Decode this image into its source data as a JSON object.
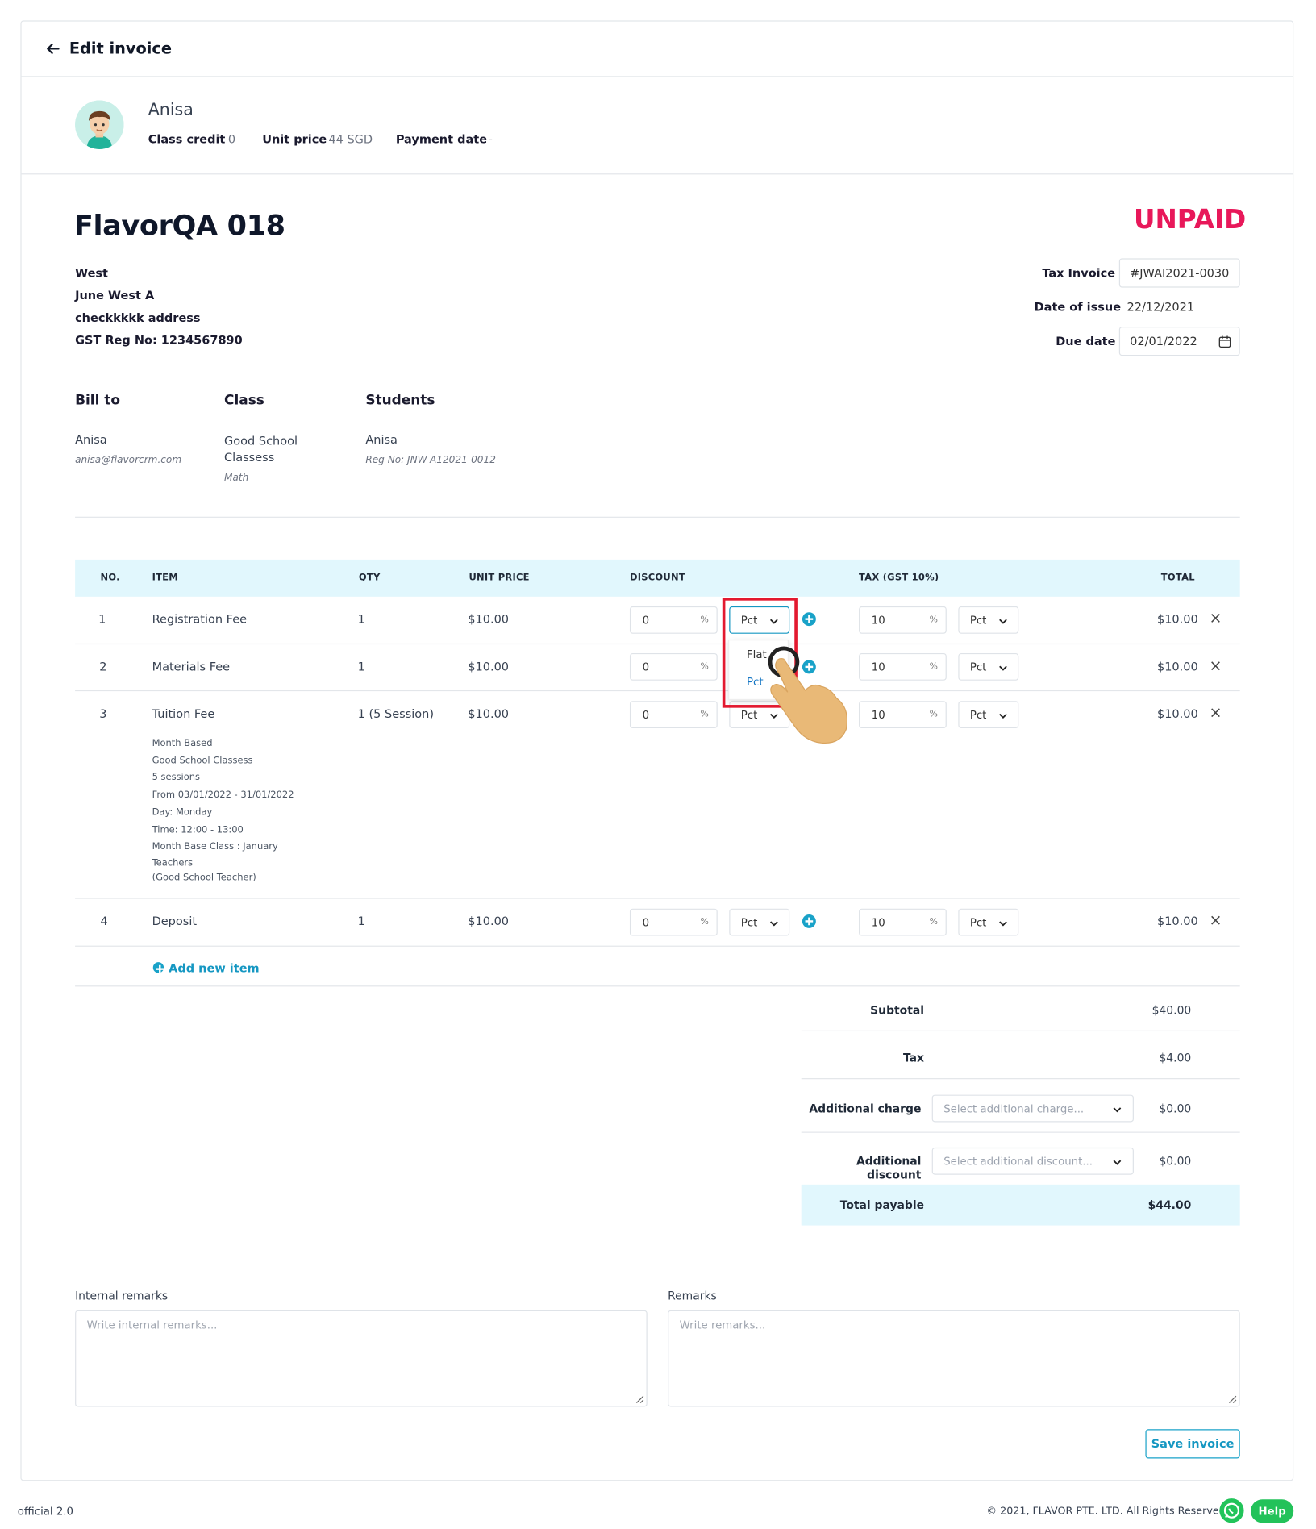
{
  "header": {
    "title": "Edit invoice"
  },
  "student": {
    "name": "Anisa",
    "class_credit_label": "Class credit",
    "class_credit_value": "0",
    "unit_price_label": "Unit price",
    "unit_price_value": "44 SGD",
    "payment_date_label": "Payment date",
    "payment_date_value": "-"
  },
  "invoice": {
    "title": "FlavorQA 018",
    "status": "UNPAID",
    "status_color": "#e8185a",
    "company": [
      "West",
      "June West A",
      "checkkkkk address",
      "GST Reg No: 1234567890"
    ],
    "tax_invoice_label": "Tax Invoice",
    "tax_invoice_value": "#JWAI2021-0030",
    "date_of_issue_label": "Date of issue",
    "date_of_issue_value": "22/12/2021",
    "due_date_label": "Due date",
    "due_date_value": "02/01/2022"
  },
  "parties": {
    "bill_to_label": "Bill to",
    "bill_to_name": "Anisa",
    "bill_to_email": "anisa@flavorcrm.com",
    "class_label": "Class",
    "class_name": "Good School Classess",
    "class_subject": "Math",
    "students_label": "Students",
    "student_name": "Anisa",
    "student_reg": "Reg No: JNW-A12021-0012"
  },
  "table": {
    "headers": {
      "no": "NO.",
      "item": "ITEM",
      "qty": "QTY",
      "unit_price": "UNIT PRICE",
      "discount": "DISCOUNT",
      "tax": "TAX (GST 10%)",
      "total": "TOTAL"
    },
    "rows": [
      {
        "no": "1",
        "item": "Registration Fee",
        "qty": "1",
        "unit_price": "$10.00",
        "discount": "0",
        "discount_unit": "%",
        "discount_type": "Pct",
        "tax": "10",
        "tax_unit": "%",
        "tax_type": "Pct",
        "total": "$10.00"
      },
      {
        "no": "2",
        "item": "Materials Fee",
        "qty": "1",
        "unit_price": "$10.00",
        "discount": "0",
        "discount_unit": "%",
        "discount_type": "Pct",
        "tax": "10",
        "tax_unit": "%",
        "tax_type": "Pct",
        "total": "$10.00"
      },
      {
        "no": "3",
        "item": "Tuition Fee",
        "qty": "1 (5 Session)",
        "unit_price": "$10.00",
        "discount": "0",
        "discount_unit": "%",
        "discount_type": "Pct",
        "tax": "10",
        "tax_unit": "%",
        "tax_type": "Pct",
        "total": "$10.00",
        "details": [
          "Month Based",
          "Good School Classess",
          "5 sessions",
          "From 03/01/2022 - 31/01/2022",
          "Day: Monday",
          "Time: 12:00 - 13:00",
          "Month Base Class : January",
          "Teachers",
          "(Good School Teacher)"
        ]
      },
      {
        "no": "4",
        "item": "Deposit",
        "qty": "1",
        "unit_price": "$10.00",
        "discount": "0",
        "discount_unit": "%",
        "discount_type": "Pct",
        "tax": "10",
        "tax_unit": "%",
        "tax_type": "Pct",
        "total": "$10.00"
      }
    ],
    "dropdown_options": [
      "Flat",
      "Pct"
    ],
    "add_new_item": "Add new item"
  },
  "summary": {
    "subtotal_label": "Subtotal",
    "subtotal_value": "$40.00",
    "tax_label": "Tax",
    "tax_value": "$4.00",
    "additional_charge_label": "Additional charge",
    "additional_charge_placeholder": "Select additional charge...",
    "additional_charge_value": "$0.00",
    "additional_discount_label": "Additional discount",
    "additional_discount_placeholder": "Select additional discount...",
    "additional_discount_value": "$0.00",
    "total_label": "Total payable",
    "total_value": "$44.00"
  },
  "remarks": {
    "internal_label": "Internal remarks",
    "internal_placeholder": "Write internal remarks...",
    "remarks_label": "Remarks",
    "remarks_placeholder": "Write remarks..."
  },
  "actions": {
    "save_label": "Save invoice"
  },
  "footer": {
    "version": "official 2.0",
    "copyright": "© 2021, FLAVOR PTE. LTD. All Rights Reserved.",
    "help_label": "Help"
  },
  "colors": {
    "accent": "#1597c2",
    "header_bg": "#e1f7fd",
    "highlight": "#e3192f",
    "whatsapp": "#22c45a"
  }
}
